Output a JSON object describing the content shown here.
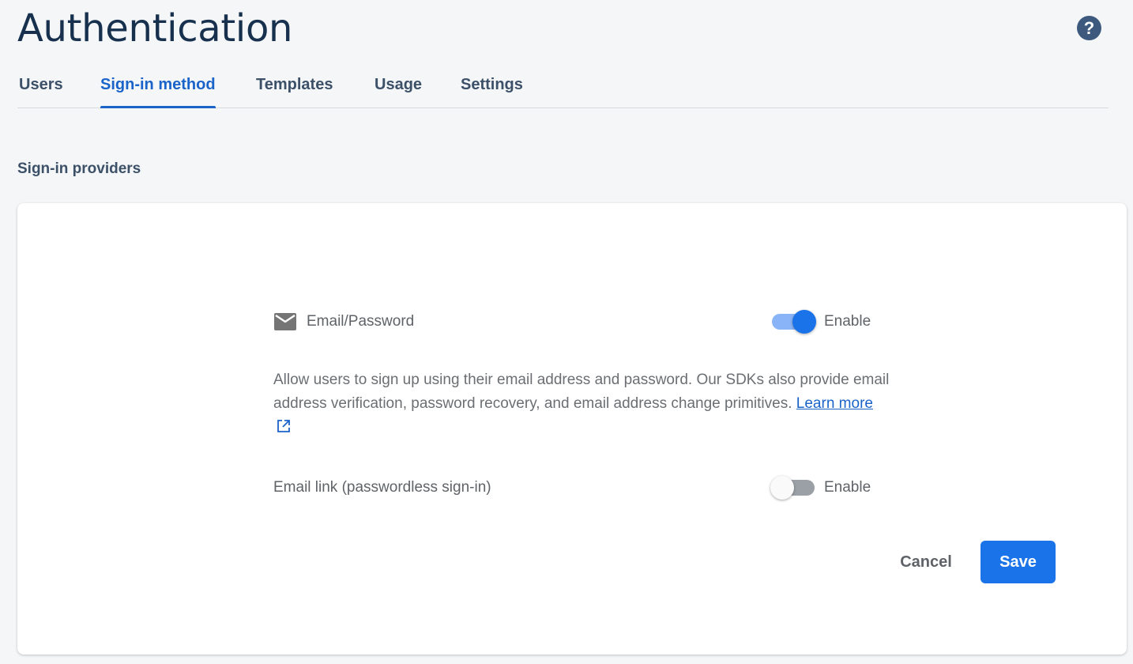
{
  "header": {
    "title": "Authentication",
    "help_icon": "help-circle-icon",
    "help_glyph": "?"
  },
  "tabs": [
    {
      "label": "Users",
      "active": false
    },
    {
      "label": "Sign-in method",
      "active": true
    },
    {
      "label": "Templates",
      "active": false
    },
    {
      "label": "Usage",
      "active": false
    },
    {
      "label": "Settings",
      "active": false
    }
  ],
  "section": {
    "title": "Sign-in providers"
  },
  "provider": {
    "icon": "mail-icon",
    "label": "Email/Password",
    "enable_label": "Enable",
    "enabled": true,
    "description": "Allow users to sign up using their email address and password. Our SDKs also provide email address verification, password recovery, and email address change primitives.",
    "learn_more": "Learn more",
    "email_link": {
      "label": "Email link (passwordless sign-in)",
      "enable_label": "Enable",
      "enabled": false
    }
  },
  "actions": {
    "cancel": "Cancel",
    "save": "Save"
  },
  "colors": {
    "accent": "#1a73e8",
    "active_tab": "#1a63c9",
    "title": "#17304d"
  }
}
